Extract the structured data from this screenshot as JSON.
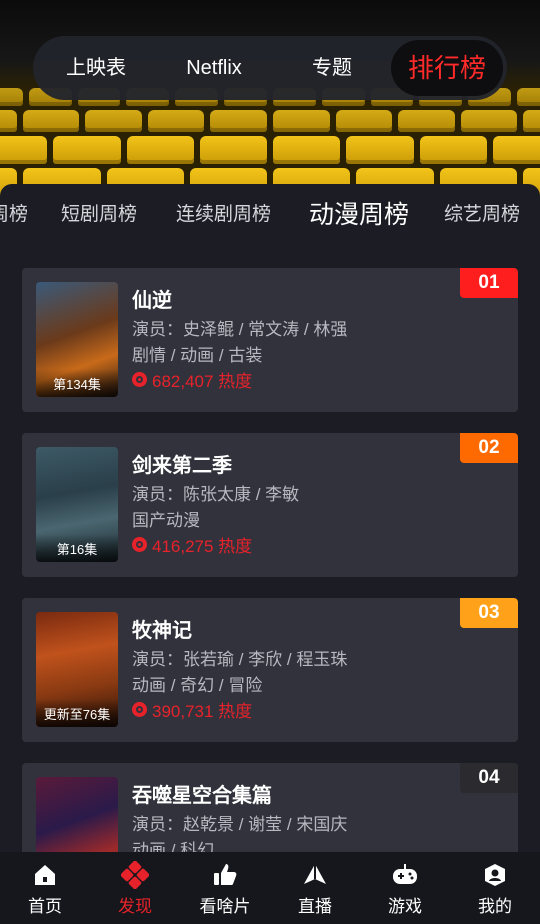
{
  "top_tabs": [
    {
      "label": "上映表"
    },
    {
      "label": "Netflix"
    },
    {
      "label": "专题"
    },
    {
      "label": "排行榜",
      "active": true
    }
  ],
  "sub_tabs": [
    {
      "label": "周榜"
    },
    {
      "label": "短剧周榜"
    },
    {
      "label": "连续剧周榜"
    },
    {
      "label": "动漫周榜",
      "active": true
    },
    {
      "label": "综艺周榜"
    }
  ],
  "ranking": [
    {
      "rank": "01",
      "title": "仙逆",
      "cast": "演员：史泽鲲 / 常文涛 / 林强",
      "genre": "剧情 / 动画 / 古装",
      "heat": "682,407 热度",
      "episode": "第134集",
      "rank_color": "#ff1e1e"
    },
    {
      "rank": "02",
      "title": "剑来第二季",
      "cast": "演员：陈张太康 / 李敏",
      "genre": "国产动漫",
      "heat": "416,275 热度",
      "episode": "第16集",
      "rank_color": "#ff6a00"
    },
    {
      "rank": "03",
      "title": "牧神记",
      "cast": "演员：张若瑜 / 李欣 / 程玉珠",
      "genre": "动画 / 奇幻 / 冒险",
      "heat": "390,731 热度",
      "episode": "更新至76集",
      "rank_color": "#ffa21a"
    },
    {
      "rank": "04",
      "title": "吞噬星空合集篇",
      "cast": "演员：赵乾景 / 谢莹 / 宋国庆",
      "genre": "动画 / 科幻",
      "heat": "",
      "episode": "",
      "rank_color": "#2b2b2f"
    }
  ],
  "bottom_nav": [
    {
      "label": "首页",
      "icon": "home-icon"
    },
    {
      "label": "发现",
      "icon": "discover-icon",
      "active": true
    },
    {
      "label": "看啥片",
      "icon": "thumbs-up-icon"
    },
    {
      "label": "直播",
      "icon": "live-icon"
    },
    {
      "label": "游戏",
      "icon": "gamepad-icon"
    },
    {
      "label": "我的",
      "icon": "profile-icon"
    }
  ],
  "colors": {
    "accent": "#e8222a",
    "card_bg": "#31323c",
    "panel_bg": "#1c1d24"
  }
}
